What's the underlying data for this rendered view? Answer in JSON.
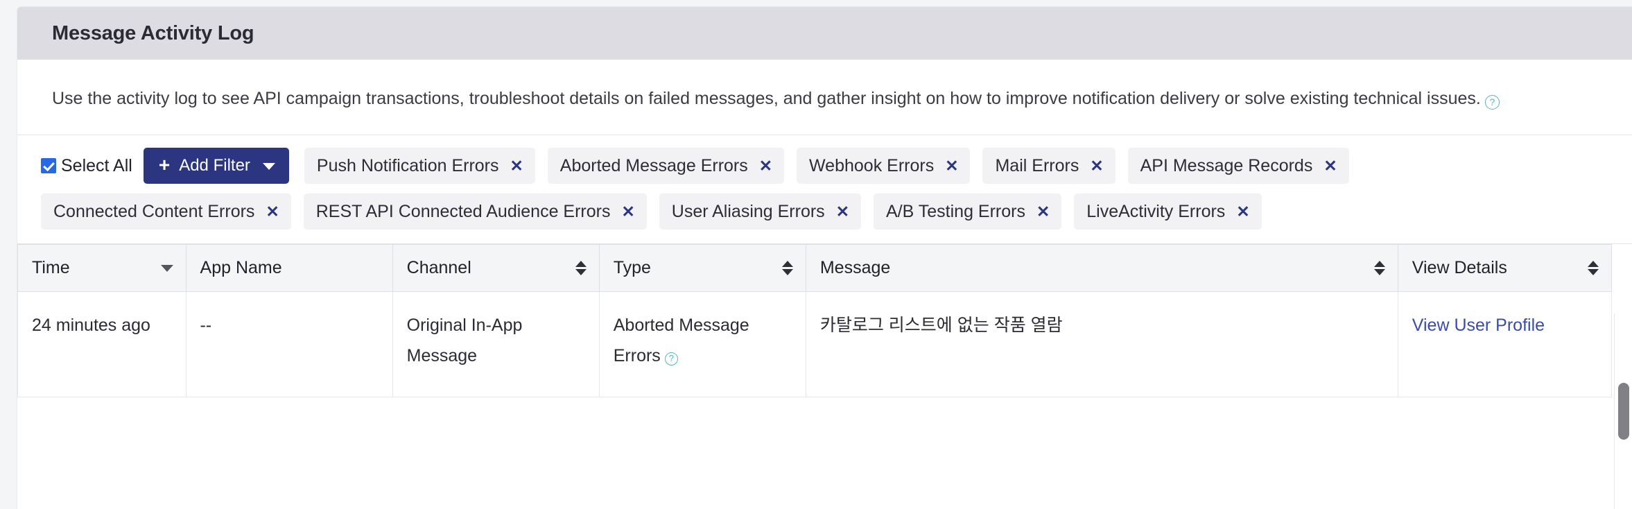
{
  "card": {
    "title": "Message Activity Log",
    "description": "Use the activity log to see API campaign transactions, troubleshoot details on failed messages, and gather insight on how to improve notification delivery or solve existing technical issues.",
    "description_help_icon": "help-circle-icon"
  },
  "filters": {
    "select_all_label": "Select All",
    "select_all_checked": true,
    "add_filter_label": "Add Filter",
    "add_filter_plus": "+",
    "add_filter_caret": "chevron-down-icon",
    "remove_glyph": "✕",
    "chips_row1": [
      "Push Notification Errors",
      "Aborted Message Errors",
      "Webhook Errors",
      "Mail Errors",
      "API Message Records"
    ],
    "chips_row2": [
      "Connected Content Errors",
      "REST API Connected Audience Errors",
      "User Aliasing Errors",
      "A/B Testing Errors",
      "LiveActivity Errors"
    ]
  },
  "table": {
    "columns": [
      {
        "label": "Time",
        "sort": "desc"
      },
      {
        "label": "App Name",
        "sort": "none"
      },
      {
        "label": "Channel",
        "sort": "both"
      },
      {
        "label": "Type",
        "sort": "both"
      },
      {
        "label": "Message",
        "sort": "both"
      },
      {
        "label": "View Details",
        "sort": "both"
      }
    ],
    "rows": [
      {
        "time": "24 minutes ago",
        "app_name": "--",
        "channel": "Original In-App Message",
        "type": "Aborted Message Errors",
        "type_help_icon": "help-circle-icon",
        "message": "카탈로그 리스트에 없는 작품 열람",
        "view_details": "View User Profile"
      }
    ]
  },
  "colors": {
    "header_bg": "#dcdce2",
    "accent_blue": "#2b3580",
    "checkbox_blue": "#2668e8",
    "link_blue": "#3b4ba8",
    "help_teal": "#55b7bd",
    "chip_bg": "#f2f2f5",
    "page_bg": "#f4f5f7"
  }
}
